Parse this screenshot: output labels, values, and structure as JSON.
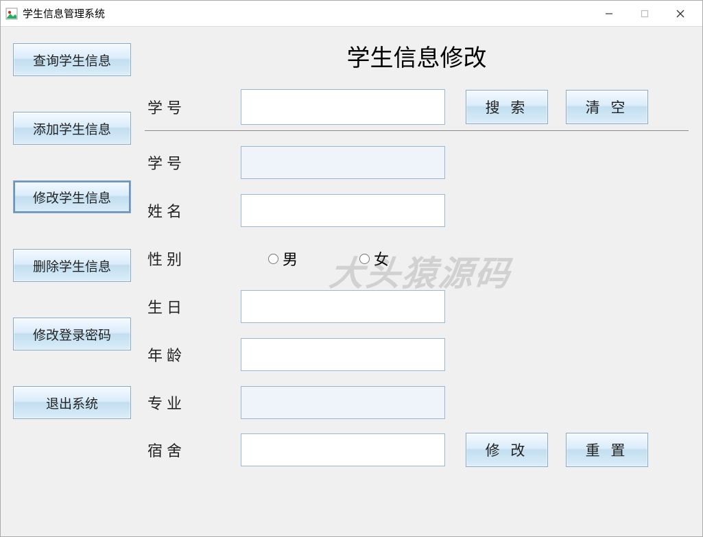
{
  "window": {
    "title": "学生信息管理系统"
  },
  "sidebar": {
    "items": [
      {
        "label": "查询学生信息"
      },
      {
        "label": "添加学生信息"
      },
      {
        "label": "修改学生信息"
      },
      {
        "label": "删除学生信息"
      },
      {
        "label": "修改登录密码"
      },
      {
        "label": "退出系统"
      }
    ]
  },
  "main": {
    "title": "学生信息修改",
    "searchLabel": "学号"
  },
  "buttons": {
    "search": "搜 索",
    "clear": "清 空",
    "modify": "修 改",
    "reset": "重 置"
  },
  "fields": {
    "id": {
      "label": "学号",
      "value": ""
    },
    "name": {
      "label": "姓名",
      "value": ""
    },
    "gender": {
      "label": "性别",
      "male": "男",
      "female": "女"
    },
    "birthday": {
      "label": "生日",
      "value": ""
    },
    "age": {
      "label": "年龄",
      "value": ""
    },
    "major": {
      "label": "专业",
      "value": ""
    },
    "dorm": {
      "label": "宿舍",
      "value": ""
    }
  },
  "watermark": "大头猿源码"
}
